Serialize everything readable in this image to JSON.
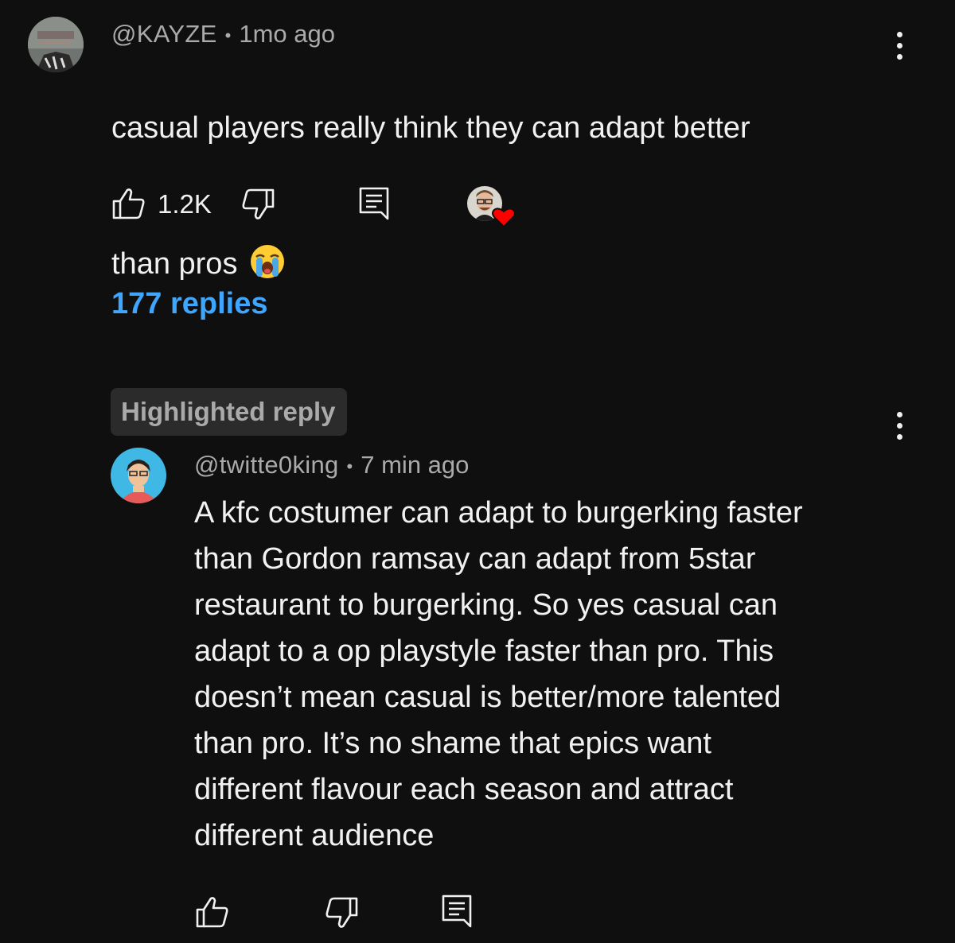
{
  "comment": {
    "author": "@KAYZE",
    "separator": "•",
    "time": "1mo ago",
    "text_line1": "casual players really think they can adapt better",
    "text_line2": "than pros",
    "emoji": "😭",
    "likes": "1.2K",
    "icons": {
      "like": "thumbs-up-icon",
      "dislike": "thumbs-down-icon",
      "reply": "reply-icon",
      "menu": "more-vert-icon",
      "heart": "creator-heart-icon"
    }
  },
  "replies": {
    "label": "177 replies"
  },
  "highlighted_reply": {
    "badge": "Highlighted reply",
    "author": "@twitte0king",
    "separator": "•",
    "time": "7 min ago",
    "text": "A kfc costumer can adapt to burgerking faster\nthan Gordon ramsay can adapt from 5star\nrestaurant to burgerking. So yes casual can\nadapt to a op playstyle faster than pro. This\ndoesn’t mean casual is better/more talented\nthan pro. It’s no shame that epics want\ndifferent flavour each season and attract\ndifferent audience"
  },
  "colors": {
    "background": "#0f0f0f",
    "text": "#f1f1f1",
    "secondary_text": "#aaaaaa",
    "link": "#3ea6ff",
    "badge_bg": "#2b2b2b",
    "heart": "#ff0000"
  }
}
